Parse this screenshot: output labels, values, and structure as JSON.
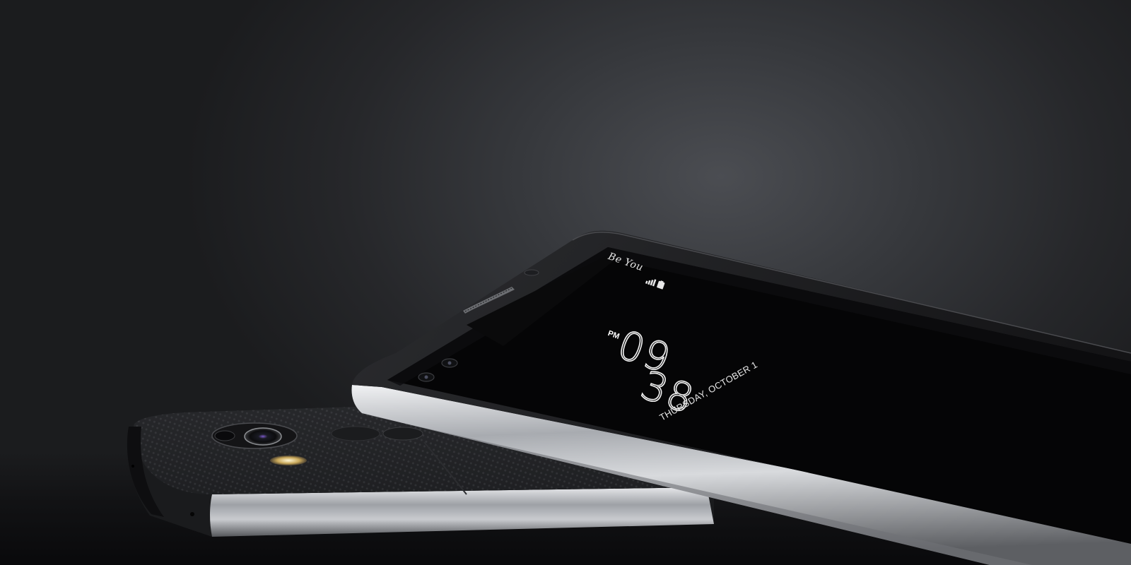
{
  "scene": {
    "background_color": "#2a2b2e",
    "accent_metal": "#b9bbbf"
  },
  "lockscreen": {
    "greeting": "Be You",
    "ampm": "PM",
    "hour": "09",
    "minute": "38",
    "date": "THURSDAY, OCTOBER 1",
    "status_icons": [
      "signal-icon",
      "battery-icon"
    ]
  }
}
